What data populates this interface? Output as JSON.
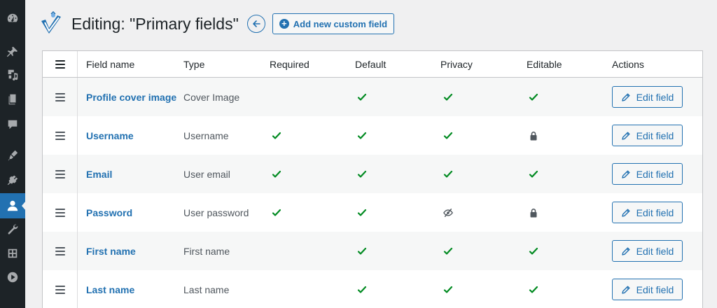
{
  "header": {
    "title": "Editing: \"Primary fields\"",
    "add_button_label": "Add new custom field"
  },
  "table": {
    "columns": [
      "Field name",
      "Type",
      "Required",
      "Default",
      "Privacy",
      "Editable",
      "Actions"
    ],
    "rows": [
      {
        "name": "Profile cover image",
        "type": "Cover Image",
        "required": "none",
        "default": "check",
        "privacy": "check",
        "editable": "check",
        "action": "Edit field"
      },
      {
        "name": "Username",
        "type": "Username",
        "required": "check",
        "default": "check",
        "privacy": "check",
        "editable": "lock",
        "action": "Edit field"
      },
      {
        "name": "Email",
        "type": "User email",
        "required": "check",
        "default": "check",
        "privacy": "check",
        "editable": "check",
        "action": "Edit field"
      },
      {
        "name": "Password",
        "type": "User password",
        "required": "check",
        "default": "check",
        "privacy": "eye-slash",
        "editable": "lock",
        "action": "Edit field"
      },
      {
        "name": "First name",
        "type": "First name",
        "required": "none",
        "default": "check",
        "privacy": "check",
        "editable": "check",
        "action": "Edit field"
      },
      {
        "name": "Last name",
        "type": "Last name",
        "required": "none",
        "default": "check",
        "privacy": "check",
        "editable": "check",
        "action": "Edit field"
      }
    ]
  },
  "sidebar": {
    "icons": [
      "dashboard-icon",
      "pin-icon",
      "media-icon",
      "pages-icon",
      "comments-icon",
      "appearance-icon",
      "plugins-icon",
      "users-icon",
      "tools-icon",
      "settings-icon",
      "play-icon"
    ],
    "active": "users-icon"
  },
  "colors": {
    "accent": "#2271b1",
    "check": "#008a20",
    "sidebar": "#1d2327",
    "background": "#f0f0f1"
  }
}
